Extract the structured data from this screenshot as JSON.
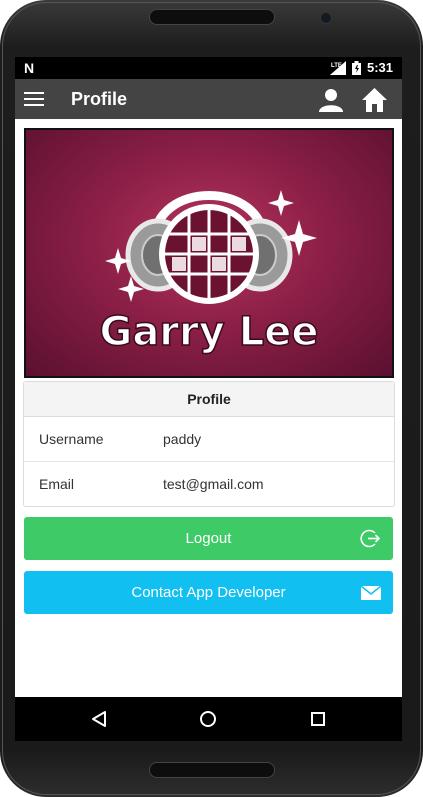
{
  "status_bar": {
    "notification_icon": "n-notification-icon",
    "network": "LTE",
    "time": "5:31"
  },
  "app_bar": {
    "title": "Profile",
    "menu_icon": "hamburger-menu-icon",
    "profile_icon": "person-icon",
    "home_icon": "home-icon"
  },
  "banner": {
    "logo_text": "Garry Lee"
  },
  "profile_card": {
    "header": "Profile",
    "rows": [
      {
        "label": "Username",
        "value": "paddy"
      },
      {
        "label": "Email",
        "value": "test@gmail.com"
      }
    ]
  },
  "buttons": {
    "logout_label": "Logout",
    "contact_label": "Contact App Developer"
  },
  "colors": {
    "app_bar": "#444444",
    "logout": "#3ecb67",
    "contact": "#11c0f0",
    "banner": "#8c1f47"
  },
  "nav_bar": {
    "back_icon": "back-triangle-icon",
    "home_icon": "home-circle-icon",
    "recents_icon": "recents-square-icon"
  }
}
